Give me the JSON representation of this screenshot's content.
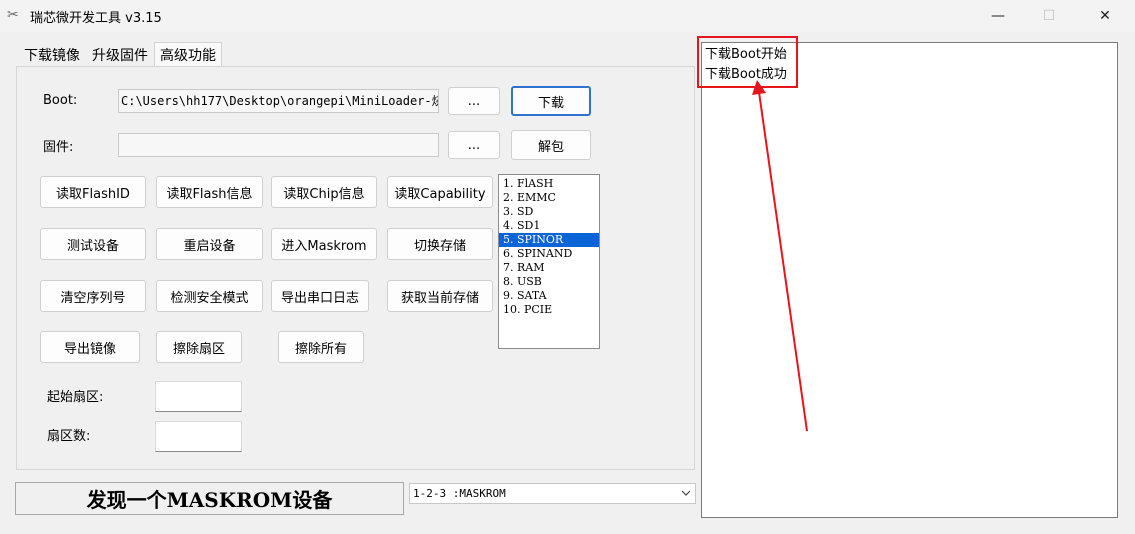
{
  "window": {
    "title": "瑞芯微开发工具 v3.15",
    "minimize": "—",
    "maximize": "☐",
    "close": "✕"
  },
  "tabs": [
    "下载镜像",
    "升级固件",
    "高级功能"
  ],
  "advanced": {
    "boot_label": "Boot:",
    "boot_path": "C:\\Users\\hh177\\Desktop\\orangepi\\MiniLoader-烧",
    "browse": "...",
    "download": "下载",
    "firmware_label": "固件:",
    "firmware_path": "",
    "unpack": "解包",
    "buttons": [
      "读取FlashID",
      "读取Flash信息",
      "读取Chip信息",
      "读取Capability",
      "测试设备",
      "重启设备",
      "进入Maskrom",
      "切换存储",
      "清空序列号",
      "检测安全模式",
      "导出串口日志",
      "获取当前存储",
      "导出镜像",
      "擦除扇区",
      "擦除所有"
    ],
    "storage_list": [
      "1. FlASH",
      "2. EMMC",
      "3. SD",
      "4. SD1",
      "5. SPINOR",
      "6. SPINAND",
      "7. RAM",
      "8. USB",
      "9. SATA",
      "10. PCIE"
    ],
    "start_sector_label": "起始扇区:",
    "sector_count_label": "扇区数:"
  },
  "status_text": "发现一个MASKROM设备",
  "device_combo": "1-2-3 :MASKROM",
  "log": [
    "下载Boot开始",
    "下载Boot成功"
  ],
  "colors": {
    "selection": "#0a64d6",
    "annotation": "#e8141b",
    "primary_border": "#2f72d0"
  }
}
